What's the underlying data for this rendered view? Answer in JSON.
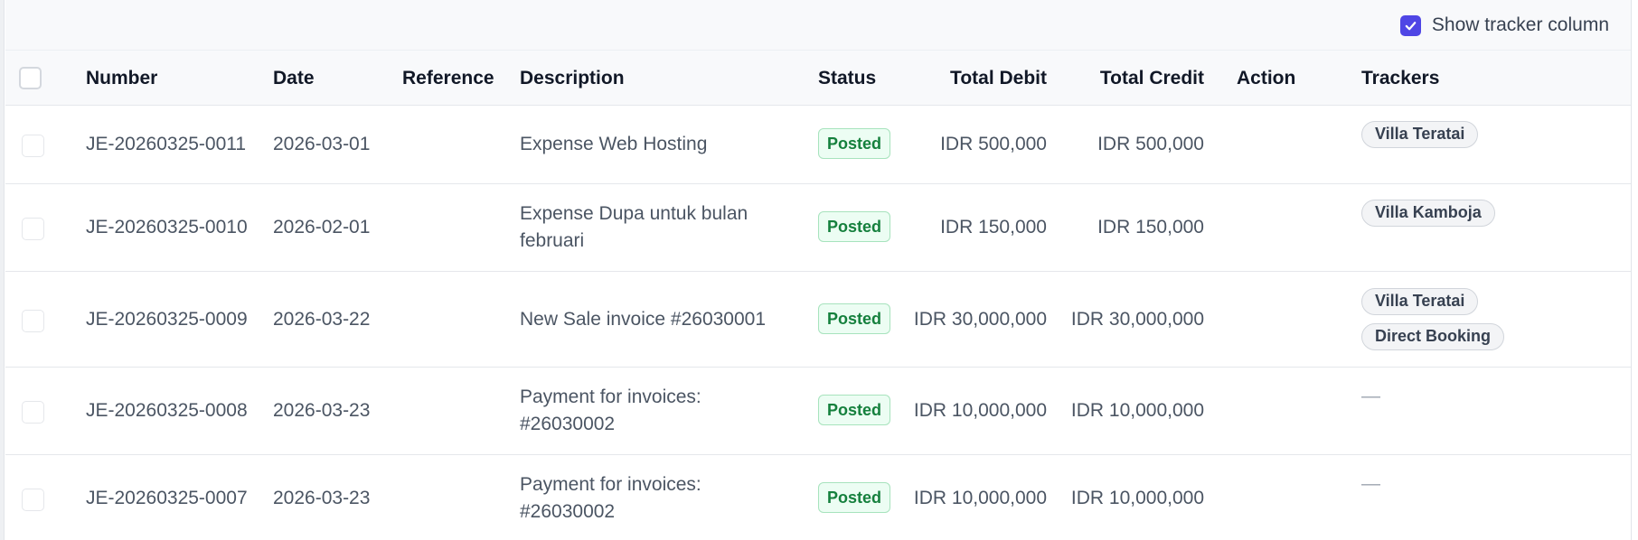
{
  "toolbar": {
    "show_tracker_label": "Show tracker column",
    "show_tracker_checked": true
  },
  "columns": {
    "number": "Number",
    "date": "Date",
    "reference": "Reference",
    "description": "Description",
    "status": "Status",
    "total_debit": "Total Debit",
    "total_credit": "Total Credit",
    "action": "Action",
    "trackers": "Trackers"
  },
  "rows": [
    {
      "number": "JE-20260325-0011",
      "date": "2026-03-01",
      "reference": "",
      "description": "Expense Web Hosting",
      "status": "Posted",
      "total_debit": "IDR 500,000",
      "total_credit": "IDR 500,000",
      "trackers": [
        "Villa Teratai"
      ]
    },
    {
      "number": "JE-20260325-0010",
      "date": "2026-02-01",
      "reference": "",
      "description": "Expense Dupa untuk bulan februari",
      "status": "Posted",
      "total_debit": "IDR 150,000",
      "total_credit": "IDR 150,000",
      "trackers": [
        "Villa Kamboja"
      ]
    },
    {
      "number": "JE-20260325-0009",
      "date": "2026-03-22",
      "reference": "",
      "description": "New Sale invoice #26030001",
      "status": "Posted",
      "total_debit": "IDR 30,000,000",
      "total_credit": "IDR 30,000,000",
      "trackers": [
        "Villa Teratai",
        "Direct Booking"
      ]
    },
    {
      "number": "JE-20260325-0008",
      "date": "2026-03-23",
      "reference": "",
      "description": "Payment for invoices: #26030002",
      "status": "Posted",
      "total_debit": "IDR 10,000,000",
      "total_credit": "IDR 10,000,000",
      "trackers": [],
      "trackers_empty": "—"
    },
    {
      "number": "JE-20260325-0007",
      "date": "2026-03-23",
      "reference": "",
      "description": "Payment for invoices: #26030002",
      "status": "Posted",
      "total_debit": "IDR 10,000,000",
      "total_credit": "IDR 10,000,000",
      "trackers": [],
      "trackers_empty": "—"
    }
  ],
  "colors": {
    "accent": "#4f46e5",
    "posted_bg": "#ecfdf3",
    "posted_text": "#15803d"
  }
}
